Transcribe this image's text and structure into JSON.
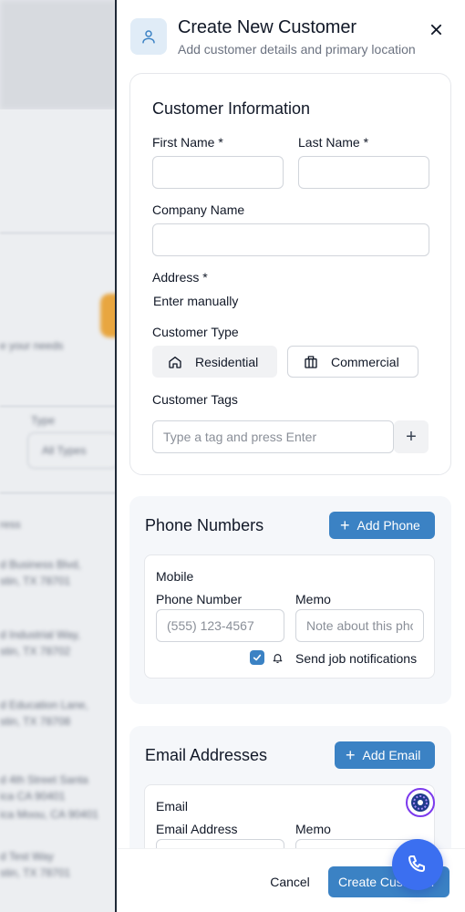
{
  "background": {
    "texts": [
      "e your needs",
      "Type",
      "All Types",
      "ress",
      "d Business Blvd,",
      "stin, TX 78701",
      "d Industrial Way,",
      "stin, TX 78702",
      "d Education Lane,",
      "stin, TX 78708",
      "d 4th Street Santa",
      "ica CA 90401",
      "ica Moou, CA 90401",
      "d Test Way",
      "stin, TX 78701"
    ]
  },
  "header": {
    "title": "Create New Customer",
    "subtitle": "Add customer details and primary location",
    "icon": "user-icon",
    "close_icon": "close-icon"
  },
  "customer_info": {
    "title": "Customer Information",
    "first_name_label": "First Name *",
    "first_name_value": "",
    "last_name_label": "Last Name *",
    "last_name_value": "",
    "company_label": "Company Name",
    "company_value": "",
    "address_label": "Address *",
    "address_mode": "Enter manually",
    "customer_type_label": "Customer Type",
    "types": [
      {
        "label": "Residential",
        "icon": "home-icon",
        "selected": true
      },
      {
        "label": "Commercial",
        "icon": "building-icon",
        "selected": false
      }
    ],
    "tags_label": "Customer Tags",
    "tags_placeholder": "Type a tag and press Enter",
    "tag_add": "+"
  },
  "phones": {
    "title": "Phone Numbers",
    "add_label": "Add Phone",
    "entry": {
      "type": "Mobile",
      "number_label": "Phone Number",
      "number_placeholder": "(555) 123-4567",
      "memo_label": "Memo",
      "memo_placeholder": "Note about this phone",
      "notify_label": "Send job notifications",
      "notify_checked": true
    }
  },
  "emails": {
    "title": "Email Addresses",
    "add_label": "Add Email",
    "entry": {
      "type": "Email",
      "address_label": "Email Address",
      "memo_label": "Memo"
    }
  },
  "footer": {
    "cancel_label": "Cancel",
    "create_label": "Create Customer"
  },
  "colors": {
    "accent": "#3b82c4",
    "fab": "#3b6ff0"
  }
}
